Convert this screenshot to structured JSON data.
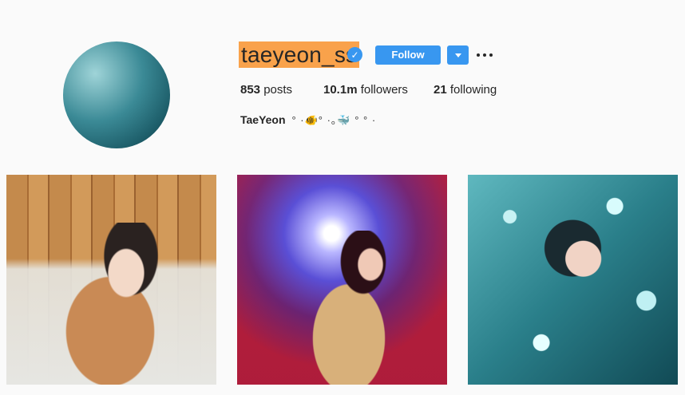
{
  "profile": {
    "username": "taeyeon_ss",
    "verified": true,
    "follow_label": "Follow",
    "stats": {
      "posts_count": "853",
      "posts_label": "posts",
      "followers_count": "10.1m",
      "followers_label": "followers",
      "following_count": "21",
      "following_label": "following"
    },
    "bio": {
      "name": "TaeYeon",
      "decoration": "°  ·🐠°  ·｡🐳  °  °  ·"
    }
  },
  "colors": {
    "accent": "#3897f0",
    "username_highlight": "#f9a24b",
    "background": "#fafafa"
  },
  "icons": {
    "verified": "verified-badge-icon",
    "dropdown": "chevron-down-icon",
    "more": "more-options-icon"
  },
  "posts": [
    {
      "name": "post-1"
    },
    {
      "name": "post-2"
    },
    {
      "name": "post-3"
    }
  ]
}
